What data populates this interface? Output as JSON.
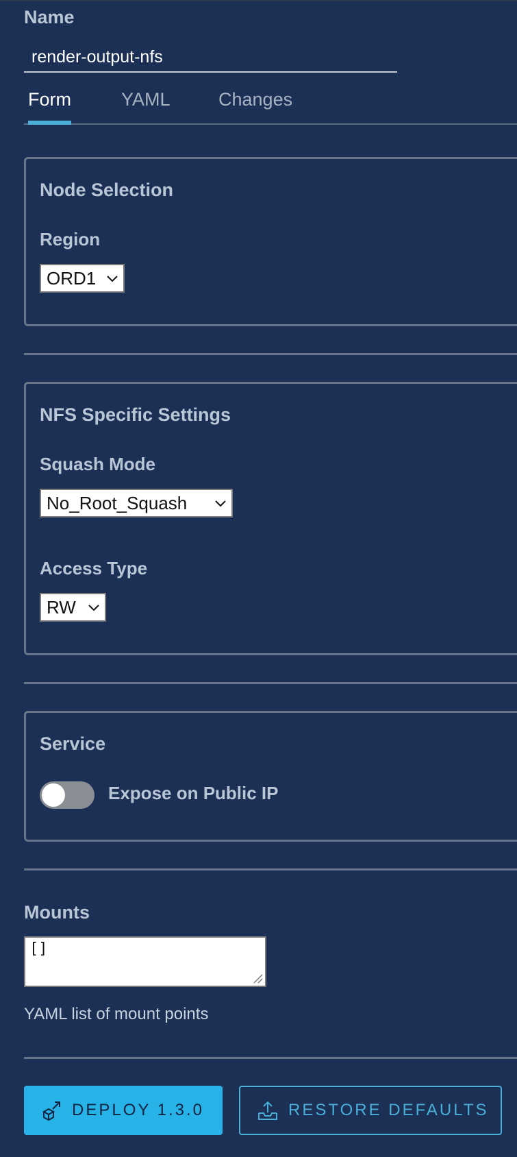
{
  "name_field": {
    "label": "Name",
    "value": "render-output-nfs"
  },
  "tabs": [
    {
      "label": "Form"
    },
    {
      "label": "YAML"
    },
    {
      "label": "Changes"
    }
  ],
  "node_selection": {
    "title": "Node Selection",
    "region_label": "Region",
    "region_value": "ORD1"
  },
  "nfs_settings": {
    "title": "NFS Specific Settings",
    "squash_label": "Squash Mode",
    "squash_value": "No_Root_Squash",
    "access_label": "Access Type",
    "access_value": "RW"
  },
  "service": {
    "title": "Service",
    "toggle_label": "Expose on Public IP",
    "toggle_on": false
  },
  "mounts": {
    "label": "Mounts",
    "value": "[]",
    "helper": "YAML list of mount points"
  },
  "actions": {
    "deploy_label": "DEPLOY 1.3.0",
    "restore_label": "RESTORE DEFAULTS"
  },
  "colors": {
    "background": "#1c3055",
    "accent": "#49afd9",
    "primary_button": "#28b3e8",
    "border": "#66758a"
  },
  "icons": {
    "select_chevron": "chevron-down-icon",
    "deploy": "deploy-icon",
    "restore": "restore-icon",
    "resize": "resize-grip-icon"
  }
}
